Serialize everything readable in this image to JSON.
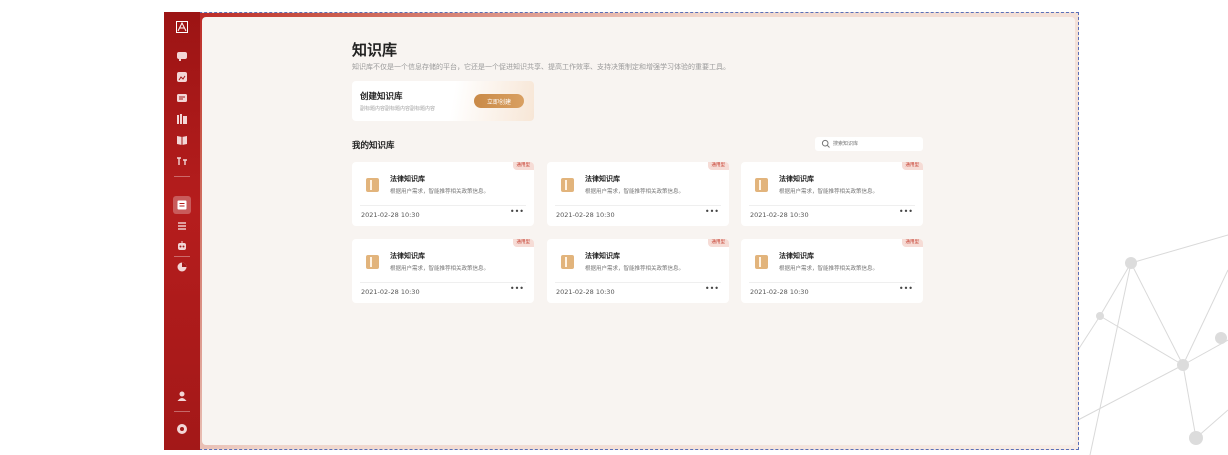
{
  "page": {
    "title": "知识库",
    "description": "知识库不仅是一个信息存储的平台，它还是一个促进知识共享、提高工作效率、支持决策制定和增强学习体验的重要工具。"
  },
  "create": {
    "title": "创建知识库",
    "subtitle": "副标题内容副标题内容副标题内容",
    "button_label": "立即创建"
  },
  "section": {
    "title": "我的知识库"
  },
  "search": {
    "placeholder": "搜索知识库"
  },
  "kb_list": [
    {
      "title": "法律知识库",
      "desc": "根据用户需求，智能推荐相关政策信息。",
      "date": "2021-02-28 10:30",
      "badge": "通用型",
      "more": "•••"
    },
    {
      "title": "法律知识库",
      "desc": "根据用户需求，智能推荐相关政策信息。",
      "date": "2021-02-28 10:30",
      "badge": "通用型",
      "more": "•••"
    },
    {
      "title": "法律知识库",
      "desc": "根据用户需求，智能推荐相关政策信息。",
      "date": "2021-02-28 10:30",
      "badge": "通用型",
      "more": "•••"
    },
    {
      "title": "法律知识库",
      "desc": "根据用户需求，智能推荐相关政策信息。",
      "date": "2021-02-28 10:30",
      "badge": "通用型",
      "more": "•••"
    },
    {
      "title": "法律知识库",
      "desc": "根据用户需求，智能推荐相关政策信息。",
      "date": "2021-02-28 10:30",
      "badge": "通用型",
      "more": "•••"
    },
    {
      "title": "法律知识库",
      "desc": "根据用户需求，智能推荐相关政策信息。",
      "date": "2021-02-28 10:30",
      "badge": "通用型",
      "more": "•••"
    }
  ],
  "sidebar": {
    "icons": [
      "app-logo-icon",
      "chat-icon",
      "image-icon",
      "message-icon",
      "library-icon",
      "book-icon",
      "text-icon",
      "knowledge-base-icon",
      "list-icon",
      "robot-icon",
      "chart-icon",
      "user-icon",
      "settings-icon"
    ]
  },
  "colors": {
    "brand_red": "#b51d1d",
    "accent_gold": "#d09450",
    "badge_text": "#c43a2b",
    "badge_bg": "#f6dcd6"
  }
}
